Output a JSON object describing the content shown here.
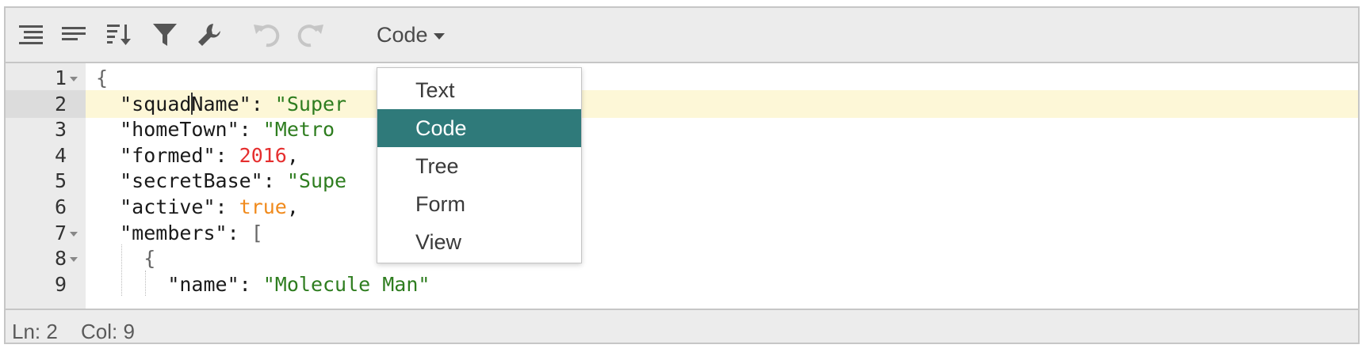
{
  "toolbar": {
    "buttons": [
      {
        "name": "format-icon",
        "enabled": true
      },
      {
        "name": "compact-icon",
        "enabled": true
      },
      {
        "name": "sort-icon",
        "enabled": true
      },
      {
        "name": "filter-icon",
        "enabled": true
      },
      {
        "name": "repair-wrench-icon",
        "enabled": true
      },
      {
        "name": "undo-icon",
        "enabled": false
      },
      {
        "name": "redo-icon",
        "enabled": false
      }
    ],
    "mode_label": "Code"
  },
  "mode_menu": {
    "items": [
      "Text",
      "Code",
      "Tree",
      "Form",
      "View"
    ],
    "selected": "Code"
  },
  "editor": {
    "active_line": 2,
    "lines": [
      {
        "num": "1",
        "fold": true,
        "tokens": [
          {
            "t": "{",
            "c": "brk"
          }
        ]
      },
      {
        "num": "2",
        "fold": false,
        "tokens": [
          {
            "t": "  ",
            "c": "p"
          },
          {
            "t": "\"squadName\"",
            "c": "key"
          },
          {
            "t": ": ",
            "c": "p"
          },
          {
            "t": "\"Super",
            "c": "str"
          }
        ]
      },
      {
        "num": "3",
        "fold": false,
        "tokens": [
          {
            "t": "  ",
            "c": "p"
          },
          {
            "t": "\"homeTown\"",
            "c": "key"
          },
          {
            "t": ": ",
            "c": "p"
          },
          {
            "t": "\"Metro",
            "c": "str"
          }
        ]
      },
      {
        "num": "4",
        "fold": false,
        "tokens": [
          {
            "t": "  ",
            "c": "p"
          },
          {
            "t": "\"formed\"",
            "c": "key"
          },
          {
            "t": ": ",
            "c": "p"
          },
          {
            "t": "2016",
            "c": "num"
          },
          {
            "t": ",",
            "c": "p"
          }
        ]
      },
      {
        "num": "5",
        "fold": false,
        "tokens": [
          {
            "t": "  ",
            "c": "p"
          },
          {
            "t": "\"secretBase\"",
            "c": "key"
          },
          {
            "t": ": ",
            "c": "p"
          },
          {
            "t": "\"Supe",
            "c": "str"
          }
        ]
      },
      {
        "num": "6",
        "fold": false,
        "tokens": [
          {
            "t": "  ",
            "c": "p"
          },
          {
            "t": "\"active\"",
            "c": "key"
          },
          {
            "t": ": ",
            "c": "p"
          },
          {
            "t": "true",
            "c": "bool"
          },
          {
            "t": ",",
            "c": "p"
          }
        ]
      },
      {
        "num": "7",
        "fold": true,
        "tokens": [
          {
            "t": "  ",
            "c": "p"
          },
          {
            "t": "\"members\"",
            "c": "key"
          },
          {
            "t": ": ",
            "c": "p"
          },
          {
            "t": "[",
            "c": "brk"
          }
        ]
      },
      {
        "num": "8",
        "fold": true,
        "tokens": [
          {
            "t": "    ",
            "c": "p"
          },
          {
            "t": "{",
            "c": "brk"
          }
        ]
      },
      {
        "num": "9",
        "fold": false,
        "tokens": [
          {
            "t": "      ",
            "c": "p"
          },
          {
            "t": "\"name\"",
            "c": "key"
          },
          {
            "t": ": ",
            "c": "p"
          },
          {
            "t": "\"Molecule Man\"",
            "c": "str"
          }
        ]
      }
    ]
  },
  "status": {
    "ln_label": "Ln: 2",
    "col_label": "Col: 9"
  },
  "colors": {
    "menu_selected_bg": "#2f7a7a",
    "string": "#2e7d1f",
    "number": "#e52e2e",
    "boolean": "#f08a1c",
    "active_line_bg": "#fdf7d7"
  }
}
